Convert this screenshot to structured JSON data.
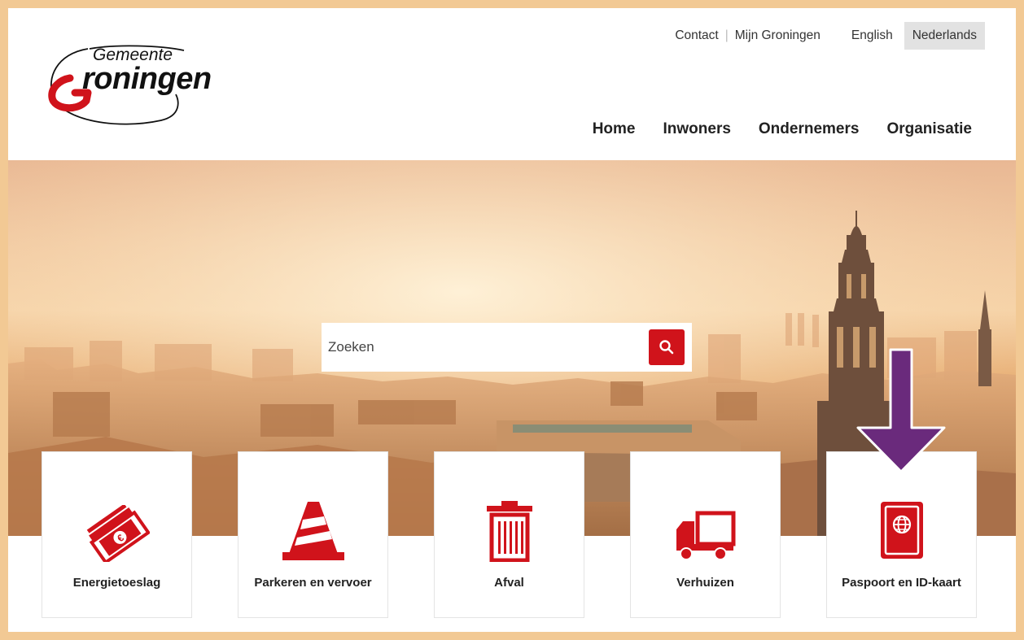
{
  "logo": {
    "top_word": "Gemeente",
    "main_word": "roningen"
  },
  "topbar": {
    "contact": "Contact",
    "mijn": "Mijn Groningen",
    "lang_en": "English",
    "lang_nl": "Nederlands"
  },
  "mainnav": [
    "Home",
    "Inwoners",
    "Ondernemers",
    "Organisatie"
  ],
  "search": {
    "placeholder": "Zoeken"
  },
  "tiles": [
    {
      "label": "Energietoeslag",
      "icon": "money-bills-icon"
    },
    {
      "label": "Parkeren en vervoer",
      "icon": "traffic-cone-icon"
    },
    {
      "label": "Afval",
      "icon": "trash-bin-icon"
    },
    {
      "label": "Verhuizen",
      "icon": "moving-truck-icon"
    },
    {
      "label": "Paspoort en ID-kaart",
      "icon": "passport-icon"
    }
  ],
  "colors": {
    "brand_red": "#d0131b",
    "frame": "#f2c994",
    "arrow": "#6a2a7c"
  }
}
